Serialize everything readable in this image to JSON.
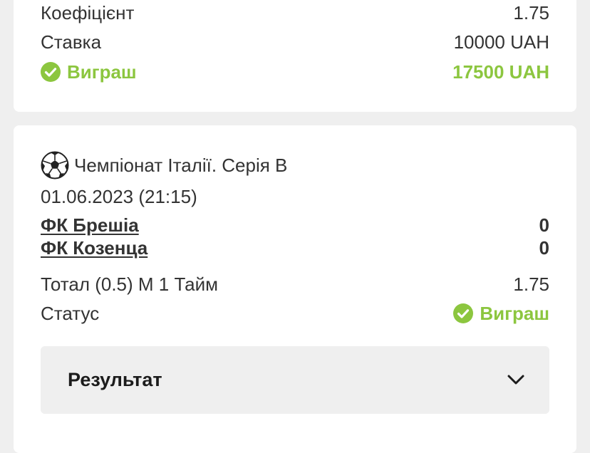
{
  "bet_summary": {
    "coefficient_label": "Коефіцієнт",
    "coefficient_value": "1.75",
    "stake_label": "Ставка",
    "stake_value": "10000 UAH",
    "win_label": "Виграш",
    "win_value": "17500 UAH"
  },
  "event": {
    "league": "Чемпіонат Італії. Серія B",
    "datetime": "01.06.2023 (21:15)",
    "team1": "ФК Брешіа",
    "team1_score": "0",
    "team2": "ФК Козенца",
    "team2_score": "0",
    "market_label": "Тотал (0.5) М 1 Тайм",
    "market_odds": "1.75",
    "status_label": "Статус",
    "status_value": "Виграш"
  },
  "result_section": {
    "label": "Результат"
  },
  "colors": {
    "win_green": "#8cc63f",
    "background": "#efefef",
    "card": "#ffffff",
    "text": "#333333"
  },
  "icons": {
    "win": "check-circle-icon",
    "sport": "soccer-ball-icon",
    "expand": "chevron-down-icon"
  }
}
